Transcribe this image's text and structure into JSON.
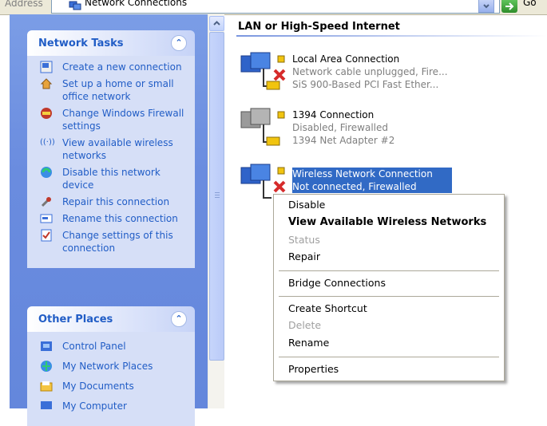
{
  "address_bar": {
    "label": "Address",
    "value": "Network Connections",
    "go_label": "Go"
  },
  "task_pane": {
    "network_tasks": {
      "title": "Network Tasks",
      "items": [
        {
          "label": "Create a new connection",
          "icon": "new-connection-icon"
        },
        {
          "label": "Set up a home or small office network",
          "icon": "home-network-icon"
        },
        {
          "label": "Change Windows Firewall settings",
          "icon": "firewall-icon"
        },
        {
          "label": "View available wireless networks",
          "icon": "wireless-icon"
        },
        {
          "label": "Disable this network device",
          "icon": "disable-device-icon"
        },
        {
          "label": "Repair this connection",
          "icon": "repair-icon"
        },
        {
          "label": "Rename this connection",
          "icon": "rename-icon"
        },
        {
          "label": "Change settings of this connection",
          "icon": "settings-icon"
        }
      ]
    },
    "other_places": {
      "title": "Other Places",
      "items": [
        {
          "label": "Control Panel",
          "icon": "control-panel-icon"
        },
        {
          "label": "My Network Places",
          "icon": "network-places-icon"
        },
        {
          "label": "My Documents",
          "icon": "documents-icon"
        },
        {
          "label": "My Computer",
          "icon": "computer-icon"
        }
      ]
    }
  },
  "content": {
    "group_title": "LAN or High-Speed Internet",
    "connections": [
      {
        "name": "Local Area Connection",
        "status": "Network cable unplugged, Fire...",
        "device": "SiS 900-Based PCI Fast Ether..."
      },
      {
        "name": "1394 Connection",
        "status": "Disabled, Firewalled",
        "device": "1394 Net Adapter #2"
      },
      {
        "name": "Wireless Network Connection",
        "status": "Not connected, Firewalled"
      }
    ]
  },
  "context_menu": {
    "items": [
      {
        "label": "Disable",
        "state": "normal"
      },
      {
        "label": "View Available Wireless Networks",
        "state": "default"
      },
      {
        "label": "Status",
        "state": "disabled"
      },
      {
        "label": "Repair",
        "state": "normal"
      },
      {
        "label": "Bridge Connections",
        "state": "normal"
      },
      {
        "label": "Create Shortcut",
        "state": "normal"
      },
      {
        "label": "Delete",
        "state": "disabled"
      },
      {
        "label": "Rename",
        "state": "normal"
      },
      {
        "label": "Properties",
        "state": "normal"
      }
    ]
  },
  "colors": {
    "task_link": "#215dc6",
    "selection": "#316ac5",
    "task_pane_bg": "#6a8cdf",
    "box_body": "#d6dff7"
  }
}
